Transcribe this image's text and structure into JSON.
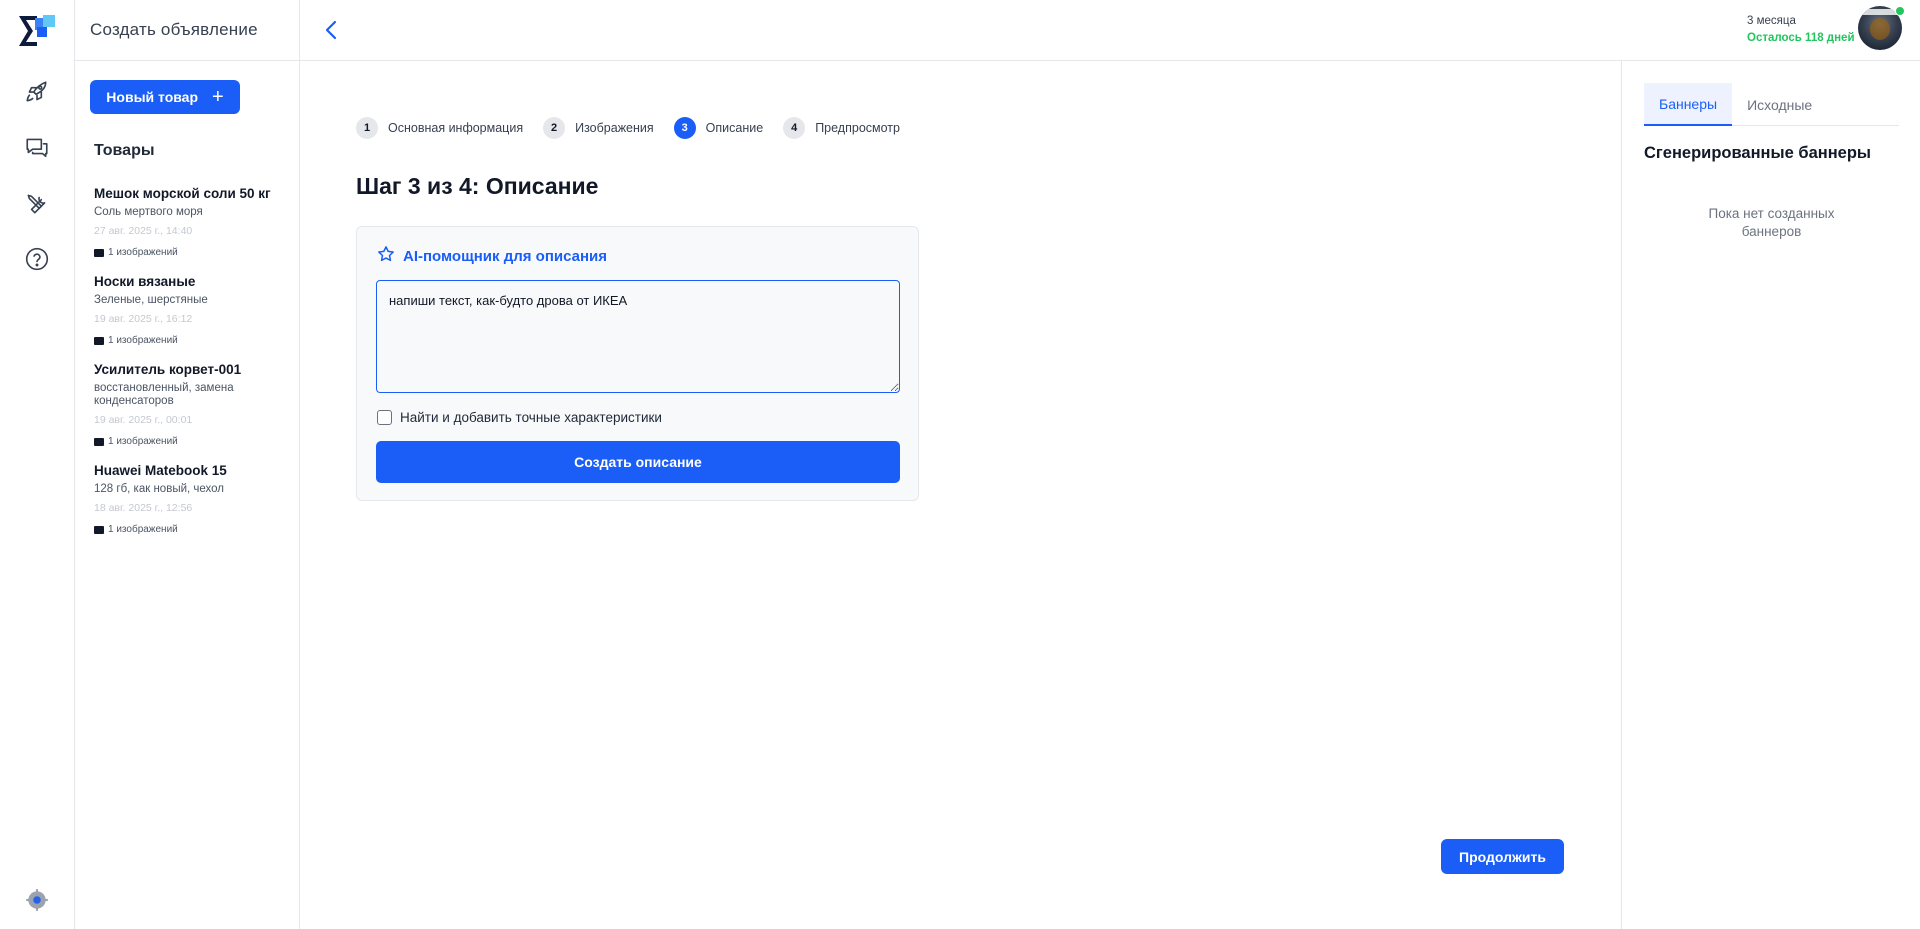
{
  "app": {
    "page_title": "Создать объявление"
  },
  "colors": {
    "accent": "#1a5ef7",
    "success": "#22c55e"
  },
  "rail": {
    "icons": [
      "rocket-icon",
      "chat-icon",
      "tools-icon",
      "help-icon",
      "settings-icon"
    ]
  },
  "sidebar": {
    "new_button_label": "Новый товар",
    "section_title": "Товары",
    "products": [
      {
        "name": "Мешок морской соли 50 кг",
        "desc": "Соль мертвого моря",
        "date": "27 авг. 2025 г., 14:40",
        "images": "1 изображений"
      },
      {
        "name": "Носки вязаные",
        "desc": "Зеленые, шерстяные",
        "date": "19 авг. 2025 г., 16:12",
        "images": "1 изображений"
      },
      {
        "name": "Усилитель корвет-001",
        "desc": "восстановленный, замена конденсаторов",
        "date": "19 авг. 2025 г., 00:01",
        "images": "1 изображений"
      },
      {
        "name": "Huawei Matebook 15",
        "desc": "128 гб, как новый, чехол",
        "date": "18 авг. 2025 г., 12:56",
        "images": "1 изображений"
      }
    ]
  },
  "topbar": {
    "subscription_period": "3 месяца",
    "days_left": "Осталось 118 дней"
  },
  "stepper": {
    "steps": [
      {
        "num": "1",
        "label": "Основная информация"
      },
      {
        "num": "2",
        "label": "Изображения"
      },
      {
        "num": "3",
        "label": "Описание"
      },
      {
        "num": "4",
        "label": "Предпросмотр"
      }
    ],
    "active_step": 3
  },
  "main": {
    "step_title": "Шаг 3 из 4: Описание",
    "ai_title": "AI-помощник для описания",
    "prompt_value": "напиши текст, как-будто дрова от ИКЕА",
    "checkbox_label": "Найти и добавить точные характеристики",
    "create_button_label": "Создать описание",
    "continue_button_label": "Продолжить"
  },
  "right_panel": {
    "tabs": [
      "Баннеры",
      "Исходные"
    ],
    "title": "Сгенерированные баннеры",
    "empty_line1": "Пока нет созданных",
    "empty_line2": "баннеров"
  }
}
